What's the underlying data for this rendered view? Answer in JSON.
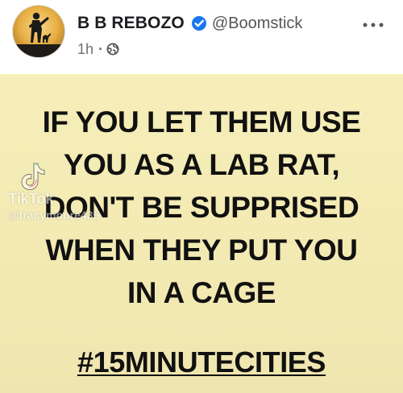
{
  "post": {
    "author": {
      "name": "B B REBOZO",
      "handle": "@Boomstick",
      "verified": true,
      "avatar_icon": "soldier-silhouette-avatar"
    },
    "meta": {
      "timestamp": "1h",
      "separator": "·",
      "visibility_icon": "globe-icon"
    },
    "more_icon": "more-horizontal-icon"
  },
  "image_text": {
    "lines": [
      "IF YOU LET THEM USE",
      "YOU AS A LAB RAT,",
      "DON'T BE SUPPRISED",
      "WHEN THEY PUT YOU",
      "IN A CAGE"
    ],
    "hashtag": "#15MINUTECITIES"
  },
  "watermark": {
    "brand": "TikTok",
    "user": "@tracymoore435",
    "icon": "tiktok-logo-icon"
  },
  "colors": {
    "image_background": "#f4ecb6",
    "verified_blue": "#1877f2",
    "text_dark": "#111111",
    "meta_gray": "#6f6f6f"
  }
}
